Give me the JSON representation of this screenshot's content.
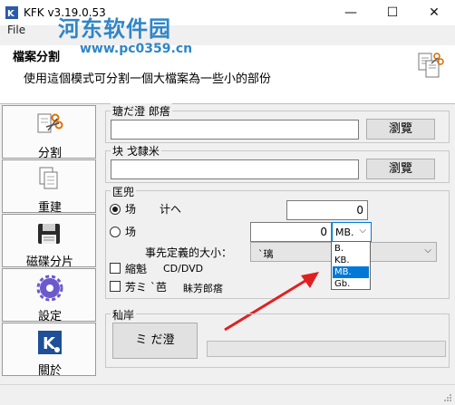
{
  "window": {
    "title": "KFK v3.19.0.53",
    "controls": {
      "minimize": "—",
      "maximize": "☐",
      "close": "✕"
    },
    "menu_file": "File"
  },
  "watermark": {
    "name": "河东软件园",
    "url": "www.pc0359.cn"
  },
  "header": {
    "title": "檔案分割",
    "subtitle": "使用這個模式可分割一個大檔案為一些小的部份"
  },
  "sidebar": {
    "items": [
      {
        "label": "分割",
        "icon": "scissors-icon"
      },
      {
        "label": "重建",
        "icon": "files-icon"
      },
      {
        "label": "磁碟分片",
        "icon": "disk-icon"
      },
      {
        "label": "設定",
        "icon": "gear-icon"
      },
      {
        "label": "關於",
        "icon": "kfk-logo-icon"
      }
    ]
  },
  "source": {
    "legend": "瑭だ澄  郎瘩",
    "value": "",
    "browse_label": "瀏覽"
  },
  "target": {
    "legend": "块  戈隸米",
    "value": "",
    "browse_label": "瀏覽"
  },
  "options": {
    "legend": "匡兜",
    "radio_count": {
      "label": "场",
      "suffix": "计ヘ",
      "value": "0",
      "selected": true
    },
    "radio_size": {
      "label": "场",
      "value": "0",
      "selected": false
    },
    "unit_combo": {
      "value": "MB.",
      "options": [
        "B.",
        "KB.",
        "MB.",
        "Gb."
      ],
      "selected_index": 2
    },
    "predefined_label": "事先定義的大小：",
    "predefined_value": "`璃",
    "checkbox_cd": {
      "label": "縮魁",
      "extra": "CD/DVD",
      "checked": false
    },
    "checkbox_misc": {
      "label": "芳ミ `芭",
      "extra": "眛芳郎瘩",
      "checked": false
    }
  },
  "progress": {
    "legend": "秈岸",
    "start_label": "ミ  だ澄",
    "fraction": 0
  },
  "colors": {
    "accent": "#0078d7",
    "watermark": "#2f86c8",
    "arrow": "#e02020"
  }
}
